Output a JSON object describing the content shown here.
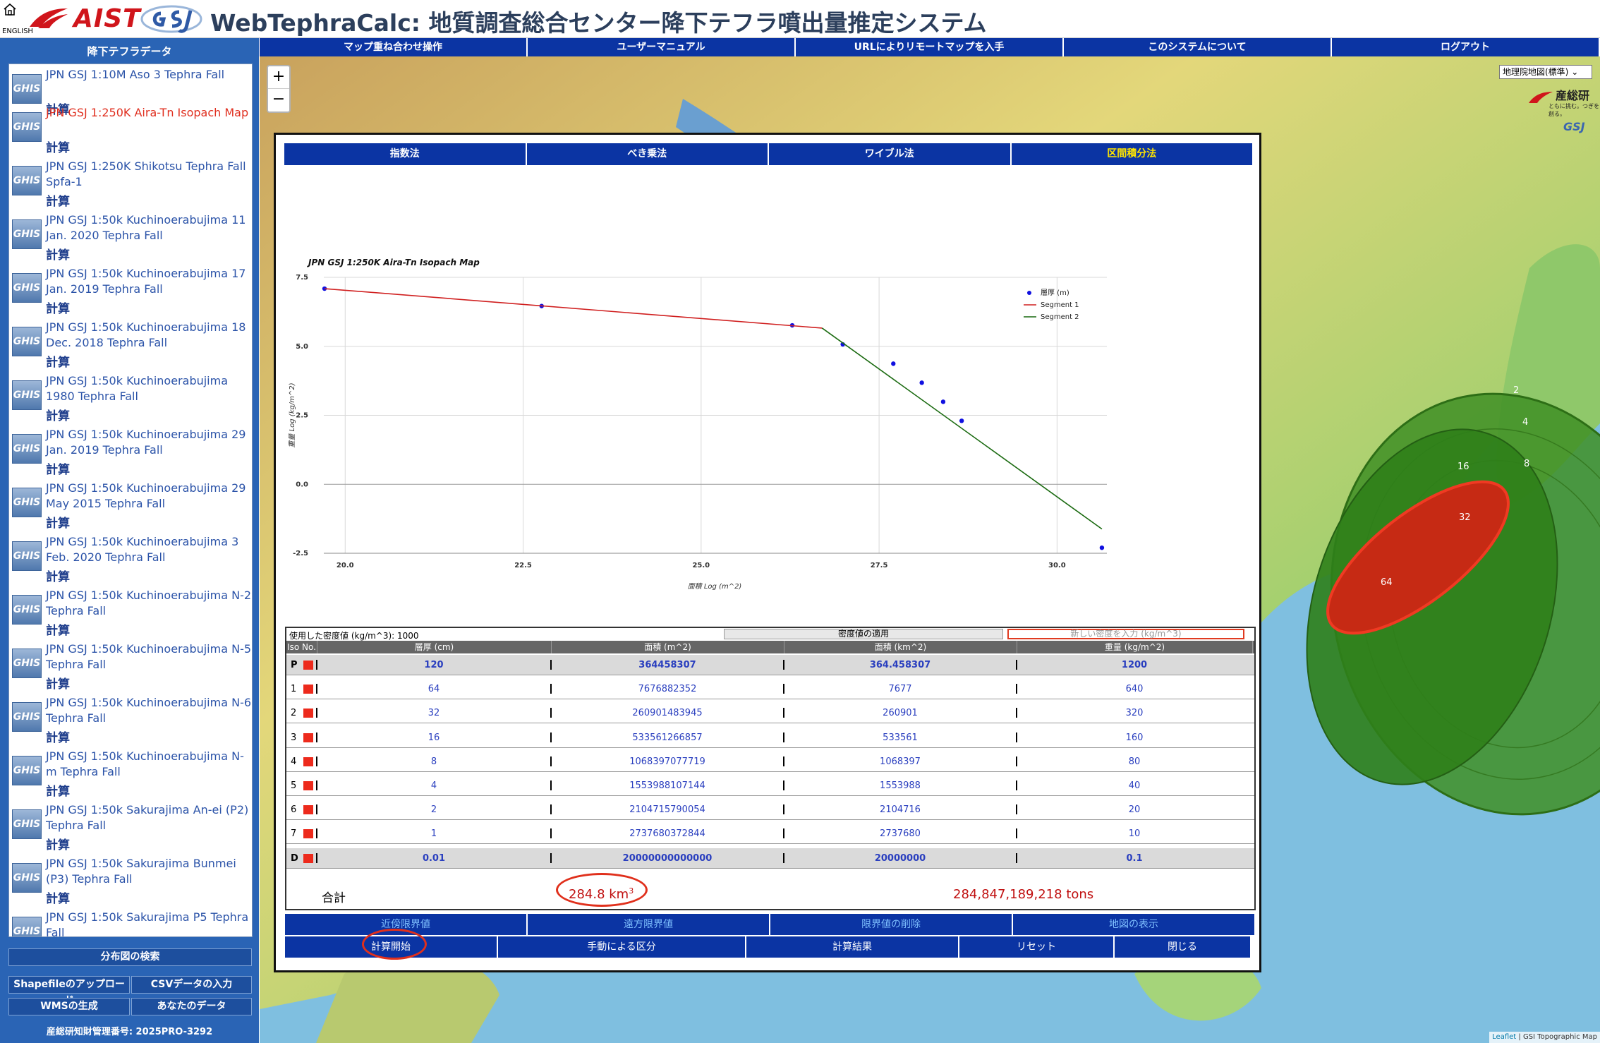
{
  "header": {
    "language_link": "ENGLISH",
    "logo_text": "AIST",
    "title": "WebTephraCalc: 地質調査総合センター降下テフラ噴出量推定システム"
  },
  "sidebar": {
    "title": "降下テフラデータ",
    "icon_label": "GHIS",
    "calc_label": "計算",
    "datasets": [
      {
        "name": "JPN GSJ 1:10M Aso 3 Tephra Fall",
        "selected": false
      },
      {
        "name": "JPN GSJ 1:250K Aira-Tn Isopach Map",
        "selected": true
      },
      {
        "name": "JPN GSJ 1:250K Shikotsu Tephra Fall Spfa-1",
        "selected": false
      },
      {
        "name": "JPN GSJ 1:50k Kuchinoerabujima 11 Jan. 2020 Tephra Fall",
        "selected": false
      },
      {
        "name": "JPN GSJ 1:50k Kuchinoerabujima 17 Jan. 2019 Tephra Fall",
        "selected": false
      },
      {
        "name": "JPN GSJ 1:50k Kuchinoerabujima 18 Dec. 2018 Tephra Fall",
        "selected": false
      },
      {
        "name": "JPN GSJ 1:50k Kuchinoerabujima 1980 Tephra Fall",
        "selected": false
      },
      {
        "name": "JPN GSJ 1:50k Kuchinoerabujima 29 Jan. 2019 Tephra Fall",
        "selected": false
      },
      {
        "name": "JPN GSJ 1:50k Kuchinoerabujima 29 May 2015 Tephra Fall",
        "selected": false
      },
      {
        "name": "JPN GSJ 1:50k Kuchinoerabujima 3 Feb. 2020 Tephra Fall",
        "selected": false
      },
      {
        "name": "JPN GSJ 1:50k Kuchinoerabujima N-2 Tephra Fall",
        "selected": false
      },
      {
        "name": "JPN GSJ 1:50k Kuchinoerabujima N-5 Tephra Fall",
        "selected": false
      },
      {
        "name": "JPN GSJ 1:50k Kuchinoerabujima N-6 Tephra Fall",
        "selected": false
      },
      {
        "name": "JPN GSJ 1:50k Kuchinoerabujima N-m Tephra Fall",
        "selected": false
      },
      {
        "name": "JPN GSJ 1:50k Sakurajima An-ei (P2) Tephra Fall",
        "selected": false
      },
      {
        "name": "JPN GSJ 1:50k Sakurajima Bunmei (P3) Tephra Fall",
        "selected": false
      },
      {
        "name": "JPN GSJ 1:50k Sakurajima P5 Tephra Fall",
        "selected": false
      }
    ],
    "search_button": "分布図の検索",
    "upload_shapefile": "Shapefileのアップロード",
    "csv_input": "CSVデータの入力",
    "wms_generate": "WMSの生成",
    "your_data": "あなたのデータ",
    "footer": "産総研知財管理番号: 2025PRO-3292"
  },
  "menu": [
    "マップ重ね合わせ操作",
    "ユーザーマニュアル",
    "URLによりリモートマップを入手",
    "このシステムについて",
    "ログアウト"
  ],
  "map": {
    "zoom_in": "+",
    "zoom_out": "−",
    "layer_select": "地理院地図(標準)",
    "aist_mini": "産総研",
    "aist_tagline": "ともに挑む。つぎを創る。",
    "gsj_mini": "GSJ",
    "credit_leaflet": "Leaflet",
    "credit_gsi": " | GSI Topographic Map",
    "contour_labels": [
      "2",
      "4",
      "8",
      "16",
      "32",
      "64"
    ],
    "colors": {
      "outer_green": "#3f8f24",
      "mid_green": "#2f7f1a",
      "core_red": "#c62a14"
    }
  },
  "dialog": {
    "method_tabs": [
      {
        "label": "指数法",
        "active": false
      },
      {
        "label": "べき乗法",
        "active": false
      },
      {
        "label": "ワイブル法",
        "active": false
      },
      {
        "label": "区間積分法",
        "active": true
      }
    ],
    "density_used": "使用した密度値 (kg/m^3): 1000",
    "density_apply": "密度値の適用",
    "density_placeholder": "新しい密度を入力 (kg/m^3)",
    "table_headers": [
      "Iso No.",
      "層厚 (cm)",
      "面積 (m^2)",
      "面積 (km^2)",
      "重量 (kg/m^2)"
    ],
    "rows": [
      {
        "iso": "P",
        "thickness": "120",
        "area_m2": "364458307",
        "area_km2": "364.458307",
        "weight": "1200"
      },
      {
        "iso": "1",
        "thickness": "64",
        "area_m2": "7676882352",
        "area_km2": "7677",
        "weight": "640"
      },
      {
        "iso": "2",
        "thickness": "32",
        "area_m2": "260901483945",
        "area_km2": "260901",
        "weight": "320"
      },
      {
        "iso": "3",
        "thickness": "16",
        "area_m2": "533561266857",
        "area_km2": "533561",
        "weight": "160"
      },
      {
        "iso": "4",
        "thickness": "8",
        "area_m2": "1068397077719",
        "area_km2": "1068397",
        "weight": "80"
      },
      {
        "iso": "5",
        "thickness": "4",
        "area_m2": "1553988107144",
        "area_km2": "1553988",
        "weight": "40"
      },
      {
        "iso": "6",
        "thickness": "2",
        "area_m2": "2104715790054",
        "area_km2": "2104716",
        "weight": "20"
      },
      {
        "iso": "7",
        "thickness": "1",
        "area_m2": "2737680372844",
        "area_km2": "2737680",
        "weight": "10"
      },
      {
        "iso": "D",
        "thickness": "0.01",
        "area_m2": "20000000000000",
        "area_km2": "20000000",
        "weight": "0.1"
      }
    ],
    "total_label": "合計",
    "total_volume_value": "284.8 km",
    "total_volume_exp": "3",
    "total_mass": "284,847,189,218 tons",
    "actions_row1": [
      "近傍限界値",
      "遠方限界値",
      "限界値の削除",
      "地図の表示"
    ],
    "actions_row2": [
      "計算開始",
      "手動による区分",
      "計算結果",
      "リセット",
      "閉じる"
    ]
  },
  "chart_data": {
    "type": "scatter",
    "title": "JPN GSJ 1:250K Aira-Tn Isopach Map",
    "xlabel": "面積 Log (m^2)",
    "ylabel": "重量 Log (kg/m^2)",
    "xlim": [
      19.7,
      30.7
    ],
    "ylim": [
      -2.5,
      7.5
    ],
    "x_ticks": [
      "20.0",
      "22.5",
      "25.0",
      "27.5",
      "30.0"
    ],
    "y_ticks": [
      "7.5",
      "5.0",
      "2.5",
      "0.0",
      "-2.5"
    ],
    "grid": true,
    "legend_position": "top-right",
    "series": [
      {
        "name": "層厚 (m)",
        "kind": "points",
        "color": "#1010e0",
        "x": [
          19.71,
          22.76,
          26.28,
          26.99,
          27.7,
          28.1,
          28.4,
          28.66,
          30.63
        ],
        "y": [
          7.09,
          6.46,
          5.76,
          5.07,
          4.37,
          3.68,
          2.99,
          2.3,
          -2.3
        ]
      },
      {
        "name": "Segment 1",
        "kind": "line",
        "color": "#d02020",
        "x": [
          19.71,
          26.7
        ],
        "y": [
          7.09,
          5.66
        ]
      },
      {
        "name": "Segment 2",
        "kind": "line",
        "color": "#1a6a10",
        "x": [
          26.7,
          30.63
        ],
        "y": [
          5.66,
          -1.62
        ]
      }
    ]
  }
}
